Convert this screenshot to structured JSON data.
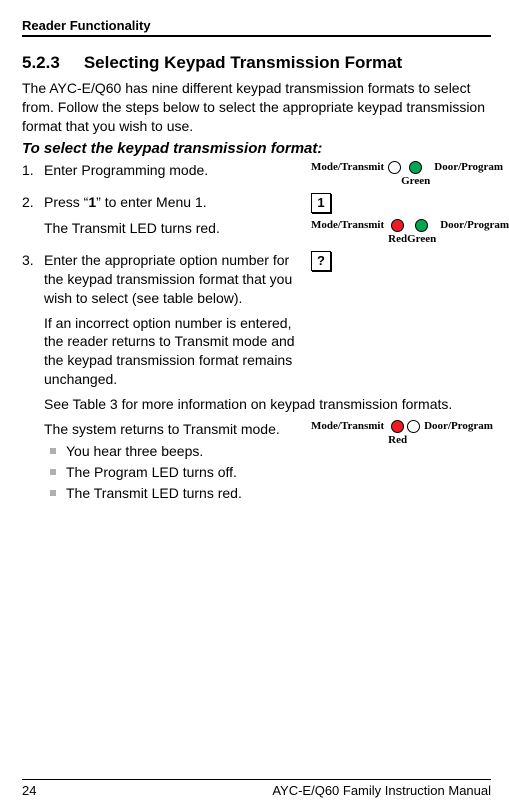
{
  "header": "Reader Functionality",
  "section": {
    "num": "5.2.3",
    "title": "Selecting Keypad Transmission Format"
  },
  "intro": "The AYC-E/Q60 has nine different keypad transmission formats to select from. Follow the steps below to select the appropriate keypad transmission format that you wish to use.",
  "subheading": "To select the keypad transmission format:",
  "labels": {
    "modeTransmit": "Mode/Transmit",
    "doorProgram": "Door/Program",
    "green": "Green",
    "red": "Red"
  },
  "step1": {
    "num": "1.",
    "text": "Enter Programming mode."
  },
  "step2": {
    "num": "2.",
    "text_a": "Press “",
    "key": "1",
    "text_b": "” to enter Menu 1.",
    "keyglyph": "1",
    "sub": "The Transmit LED turns red."
  },
  "step3": {
    "num": "3.",
    "text": "Enter the appropriate option number for the keypad transmission format that you wish to select (see table below).",
    "keyglyph": "?",
    "para2": "If an incorrect option number is entered, the reader returns to Transmit mode and the keypad transmission format remains unchanged.",
    "para3": "See Table 3 for more information on keypad transmission formats.",
    "para4": "The system returns to Transmit mode.",
    "b1": "You hear three beeps.",
    "b2": "The Program LED turns off.",
    "b3": "The Transmit LED turns red."
  },
  "footer": {
    "page": "24",
    "title": "AYC-E/Q60 Family Instruction Manual"
  }
}
